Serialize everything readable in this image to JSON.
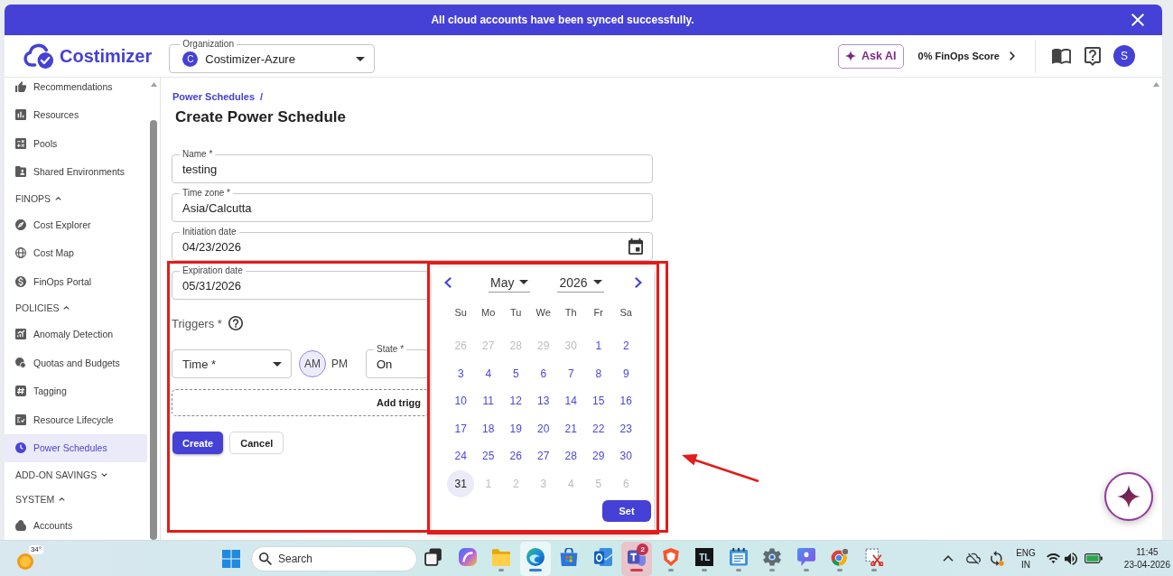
{
  "banner": {
    "message": "All cloud accounts have been synced successfully."
  },
  "header": {
    "brand": "Costimizer",
    "organization": {
      "label": "Organization",
      "avatar": "C",
      "value": "Costimizer-Azure"
    },
    "ask_ai": "Ask AI",
    "finops_score": "0% FinOps Score",
    "user_avatar": "S"
  },
  "sidebar": {
    "items": [
      {
        "kind": "link",
        "label": "Recommendations",
        "selected": false
      },
      {
        "kind": "link",
        "label": "Resources",
        "selected": false
      },
      {
        "kind": "link",
        "label": "Pools",
        "selected": false
      },
      {
        "kind": "link",
        "label": "Shared Environments",
        "selected": false
      },
      {
        "kind": "section",
        "label": "FINOPS",
        "expanded": true
      },
      {
        "kind": "link",
        "label": "Cost Explorer",
        "selected": false
      },
      {
        "kind": "link",
        "label": "Cost Map",
        "selected": false
      },
      {
        "kind": "link",
        "label": "FinOps Portal",
        "selected": false
      },
      {
        "kind": "section",
        "label": "POLICIES",
        "expanded": true
      },
      {
        "kind": "link",
        "label": "Anomaly Detection",
        "selected": false
      },
      {
        "kind": "link",
        "label": "Quotas and Budgets",
        "selected": false
      },
      {
        "kind": "link",
        "label": "Tagging",
        "selected": false
      },
      {
        "kind": "link",
        "label": "Resource Lifecycle",
        "selected": false
      },
      {
        "kind": "link",
        "label": "Power Schedules",
        "selected": true
      },
      {
        "kind": "section",
        "label": "ADD-ON SAVINGS",
        "expanded": false
      },
      {
        "kind": "section",
        "label": "SYSTEM",
        "expanded": true
      },
      {
        "kind": "link",
        "label": "Accounts",
        "selected": false
      }
    ]
  },
  "breadcrumb": {
    "link": "Power Schedules",
    "separator": "/"
  },
  "title": "Create Power Schedule",
  "form": {
    "fields": [
      {
        "kind": "text",
        "label": "Name *",
        "value": "testing",
        "covered": false
      },
      {
        "kind": "text",
        "label": "Time zone *",
        "value": "Asia/Calcutta",
        "covered": false
      },
      {
        "kind": "date",
        "label": "Initiation date",
        "value": "04/23/2026",
        "covered": false
      },
      {
        "kind": "date",
        "label": "Expiration date",
        "value": "05/31/2026",
        "covered": true
      }
    ],
    "triggers": {
      "label": "Triggers *",
      "time_select": {
        "label": "Time *"
      },
      "meridiem": [
        {
          "label": "AM",
          "selected": true
        },
        {
          "label": "PM",
          "selected": false
        }
      ],
      "state_select": {
        "label": "State *",
        "value": "On"
      },
      "add_button": "Add trigg"
    },
    "buttons": [
      {
        "kind": "primary",
        "label": "Create"
      },
      {
        "kind": "secondary",
        "label": "Cancel"
      }
    ]
  },
  "date_picker": {
    "month": "May",
    "year": "2026",
    "weekdays": [
      "Su",
      "Mo",
      "Tu",
      "We",
      "Th",
      "Fr",
      "Sa"
    ],
    "weeks": [
      [
        {
          "day": "26",
          "outside_month": true,
          "selected": false
        },
        {
          "day": "27",
          "outside_month": true,
          "selected": false
        },
        {
          "day": "28",
          "outside_month": true,
          "selected": false
        },
        {
          "day": "29",
          "outside_month": true,
          "selected": false
        },
        {
          "day": "30",
          "outside_month": true,
          "selected": false
        },
        {
          "day": "1",
          "outside_month": false,
          "selected": false
        },
        {
          "day": "2",
          "outside_month": false,
          "selected": false
        }
      ],
      [
        {
          "day": "3",
          "outside_month": false,
          "selected": false
        },
        {
          "day": "4",
          "outside_month": false,
          "selected": false
        },
        {
          "day": "5",
          "outside_month": false,
          "selected": false
        },
        {
          "day": "6",
          "outside_month": false,
          "selected": false
        },
        {
          "day": "7",
          "outside_month": false,
          "selected": false
        },
        {
          "day": "8",
          "outside_month": false,
          "selected": false
        },
        {
          "day": "9",
          "outside_month": false,
          "selected": false
        }
      ],
      [
        {
          "day": "10",
          "outside_month": false,
          "selected": false
        },
        {
          "day": "11",
          "outside_month": false,
          "selected": false
        },
        {
          "day": "12",
          "outside_month": false,
          "selected": false
        },
        {
          "day": "13",
          "outside_month": false,
          "selected": false
        },
        {
          "day": "14",
          "outside_month": false,
          "selected": false
        },
        {
          "day": "15",
          "outside_month": false,
          "selected": false
        },
        {
          "day": "16",
          "outside_month": false,
          "selected": false
        }
      ],
      [
        {
          "day": "17",
          "outside_month": false,
          "selected": false
        },
        {
          "day": "18",
          "outside_month": false,
          "selected": false
        },
        {
          "day": "19",
          "outside_month": false,
          "selected": false
        },
        {
          "day": "20",
          "outside_month": false,
          "selected": false
        },
        {
          "day": "21",
          "outside_month": false,
          "selected": false
        },
        {
          "day": "22",
          "outside_month": false,
          "selected": false
        },
        {
          "day": "23",
          "outside_month": false,
          "selected": false
        }
      ],
      [
        {
          "day": "24",
          "outside_month": false,
          "selected": false
        },
        {
          "day": "25",
          "outside_month": false,
          "selected": false
        },
        {
          "day": "26",
          "outside_month": false,
          "selected": false
        },
        {
          "day": "27",
          "outside_month": false,
          "selected": false
        },
        {
          "day": "28",
          "outside_month": false,
          "selected": false
        },
        {
          "day": "29",
          "outside_month": false,
          "selected": false
        },
        {
          "day": "30",
          "outside_month": false,
          "selected": false
        }
      ],
      [
        {
          "day": "31",
          "outside_month": false,
          "selected": true
        },
        {
          "day": "1",
          "outside_month": true,
          "selected": false
        },
        {
          "day": "2",
          "outside_month": true,
          "selected": false
        },
        {
          "day": "3",
          "outside_month": true,
          "selected": false
        },
        {
          "day": "4",
          "outside_month": true,
          "selected": false
        },
        {
          "day": "5",
          "outside_month": true,
          "selected": false
        },
        {
          "day": "6",
          "outside_month": true,
          "selected": false
        }
      ]
    ],
    "set_button": "Set"
  },
  "taskbar": {
    "weather": "34°",
    "search": {
      "placeholder": "Search"
    },
    "apps": [
      {
        "kind": "task_view",
        "running": false,
        "active": false,
        "alert": false
      },
      {
        "kind": "swirl",
        "running": false,
        "active": false,
        "alert": false
      },
      {
        "kind": "folder",
        "running": true,
        "active": false,
        "alert": false
      },
      {
        "kind": "wave",
        "running": true,
        "active": true,
        "alert": false
      },
      {
        "kind": "bag",
        "running": false,
        "active": false,
        "alert": false
      },
      {
        "kind": "mail",
        "running": false,
        "active": false,
        "alert": false
      },
      {
        "kind": "team_chat",
        "running": true,
        "active": false,
        "alert": true,
        "badge": "2"
      },
      {
        "kind": "shield",
        "running": true,
        "active": false,
        "alert": false
      },
      {
        "kind": "letter_tile",
        "label": "TL",
        "running": true,
        "active": false,
        "alert": false
      },
      {
        "kind": "notepad",
        "running": true,
        "active": false,
        "alert": false
      },
      {
        "kind": "gear",
        "running": true,
        "active": false,
        "alert": false
      },
      {
        "kind": "bubble",
        "running": true,
        "active": false,
        "alert": false
      },
      {
        "kind": "tricolor",
        "running": true,
        "active": false,
        "alert": false
      },
      {
        "kind": "scissors",
        "running": true,
        "active": false,
        "alert": false
      }
    ],
    "tray": {
      "language": "ENG",
      "region": "IN",
      "time": "11:45",
      "date": "23-04-2026"
    }
  }
}
